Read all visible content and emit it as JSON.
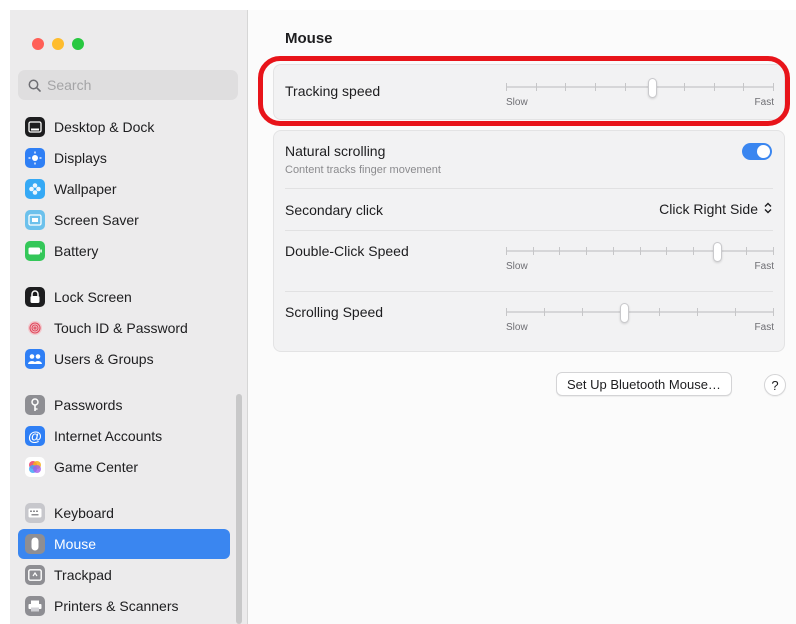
{
  "colors": {
    "accent": "#3a86f0",
    "annotation": "#e8141a",
    "traffic_red": "#ff5f57",
    "traffic_yellow": "#febc2e",
    "traffic_green": "#28c840"
  },
  "sidebar": {
    "search": {
      "placeholder": "Search",
      "icon": "search-icon"
    },
    "items": [
      {
        "label": "Desktop & Dock",
        "icon": "dock-icon"
      },
      {
        "label": "Displays",
        "icon": "displays-icon"
      },
      {
        "label": "Wallpaper",
        "icon": "wallpaper-icon"
      },
      {
        "label": "Screen Saver",
        "icon": "screen-saver-icon"
      },
      {
        "label": "Battery",
        "icon": "battery-icon"
      },
      {
        "label": "Lock Screen",
        "icon": "lock-icon"
      },
      {
        "label": "Touch ID & Password",
        "icon": "fingerprint-icon"
      },
      {
        "label": "Users & Groups",
        "icon": "users-icon"
      },
      {
        "label": "Passwords",
        "icon": "key-icon"
      },
      {
        "label": "Internet Accounts",
        "icon": "at-icon"
      },
      {
        "label": "Game Center",
        "icon": "game-center-icon"
      },
      {
        "label": "Keyboard",
        "icon": "keyboard-icon"
      },
      {
        "label": "Mouse",
        "icon": "mouse-icon",
        "selected": true
      },
      {
        "label": "Trackpad",
        "icon": "trackpad-icon"
      },
      {
        "label": "Printers & Scanners",
        "icon": "printer-icon"
      }
    ]
  },
  "main": {
    "title": "Mouse",
    "tracking": {
      "label": "Tracking speed",
      "min_label": "Slow",
      "max_label": "Fast",
      "value_fraction": 0.55
    },
    "natural_scrolling": {
      "label": "Natural scrolling",
      "description": "Content tracks finger movement",
      "enabled": true
    },
    "secondary_click": {
      "label": "Secondary click",
      "value": "Click Right Side"
    },
    "double_click": {
      "label": "Double-Click Speed",
      "min_label": "Slow",
      "max_label": "Fast",
      "value_fraction": 0.8
    },
    "scrolling_speed": {
      "label": "Scrolling Speed",
      "min_label": "Slow",
      "max_label": "Fast",
      "value_fraction": 0.44
    },
    "bluetooth_button": "Set Up Bluetooth Mouse…",
    "help_button": "?"
  }
}
